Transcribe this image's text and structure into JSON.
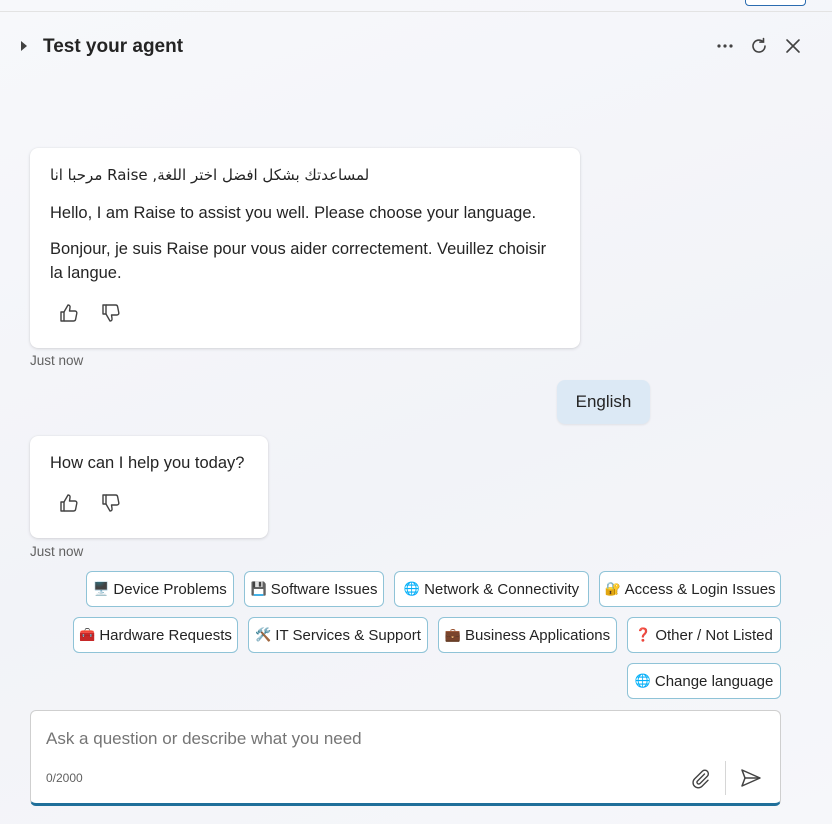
{
  "header": {
    "title": "Test your agent",
    "icons": [
      "collapse-caret-icon",
      "more-options-icon",
      "refresh-icon",
      "close-icon"
    ]
  },
  "messages": {
    "greeting": {
      "arabic": "مرحبا انا Raise ,لمساعدتك بشكل افضل اختر اللغة",
      "english": "Hello, I am Raise to assist you well. Please choose your language.",
      "french": "Bonjour, je suis Raise pour vous aider correctement. Veuillez choisir la langue.",
      "timestamp": "Just now"
    },
    "user_reply": "English",
    "help": {
      "text": "How can I help you today?",
      "timestamp": "Just now"
    }
  },
  "suggestions": [
    {
      "emoji": "🖥️",
      "label": "Device Problems"
    },
    {
      "emoji": "💾",
      "label": "Software Issues"
    },
    {
      "emoji": "🌐",
      "label": "Network & Connectivity"
    },
    {
      "emoji": "🔐",
      "label": "Access & Login Issues"
    },
    {
      "emoji": "🧰",
      "label": "Hardware Requests"
    },
    {
      "emoji": "🛠️",
      "label": "IT Services & Support"
    },
    {
      "emoji": "💼",
      "label": "Business Applications"
    },
    {
      "emoji": "❓",
      "label": "Other / Not Listed"
    },
    {
      "emoji": "🌐",
      "label": "Change language"
    }
  ],
  "composer": {
    "placeholder": "Ask a question or describe what you need",
    "counter": "0/2000"
  },
  "colors": {
    "user_bubble": "#dce9f5",
    "chip_border": "#8fc3d7",
    "composer_accent": "#1f6f9a"
  }
}
